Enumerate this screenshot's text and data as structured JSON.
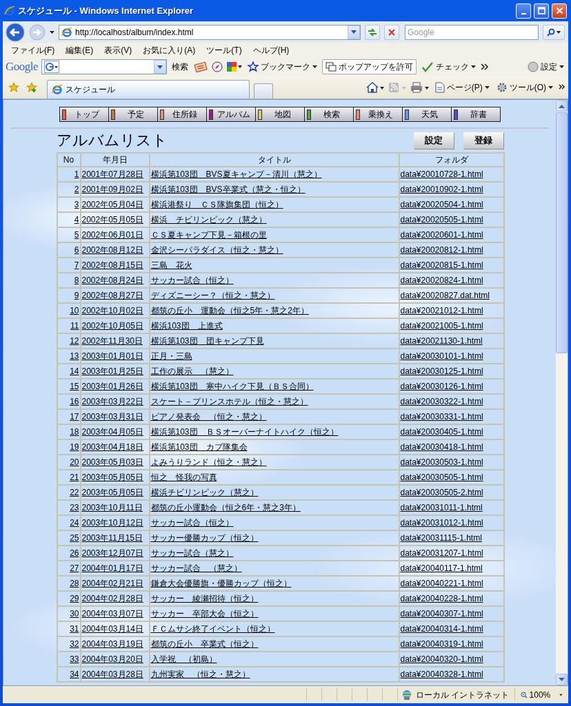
{
  "window": {
    "title": "スケジュール - Windows Internet Explorer"
  },
  "address_bar": {
    "url": "http://localhost/album/index.html"
  },
  "search_box": {
    "placeholder": "Google"
  },
  "menu_bar": [
    "ファイル(F)",
    "編集(E)",
    "表示(V)",
    "お気に入り(A)",
    "ツール(T)",
    "ヘルプ(H)"
  ],
  "google_toolbar": {
    "logo": "Google",
    "search_label": "検索",
    "bookmarks": "ブックマーク",
    "popup": "ポップアップを許可",
    "check": "チェック",
    "settings": "設定"
  },
  "tabs": [
    {
      "label": "スケジュール",
      "selected": true
    }
  ],
  "command_bar": [
    "ページ(P)",
    "ツール(O)"
  ],
  "nav": [
    {
      "label": "トップ",
      "color": "#e06050"
    },
    {
      "label": "予定",
      "color": "#c07840"
    },
    {
      "label": "住所録",
      "color": "#e09078"
    },
    {
      "label": "アルバム",
      "color": "#a01890"
    },
    {
      "label": "地図",
      "color": "#d8d060"
    },
    {
      "label": "検索",
      "color": "#58a040"
    },
    {
      "label": "乗換え",
      "color": "#e09078"
    },
    {
      "label": "天気",
      "color": "#6898e0"
    },
    {
      "label": "辞書",
      "color": "#5050c0"
    }
  ],
  "page_title": "アルバムリスト",
  "buttons": [
    "設定",
    "登録"
  ],
  "table": {
    "columns": [
      "No",
      "年月日",
      "タイトル",
      "フォルダ"
    ],
    "rows": [
      [
        "1",
        "2001年07月28日",
        "横浜第103団　BVS夏キャンプ－清川（慧之）",
        "data¥20010728-1.html"
      ],
      [
        "2",
        "2001年09月02日",
        "横浜第103団　BVS卒業式（慧之・恒之）",
        "data¥20010902-1.html"
      ],
      [
        "3",
        "2002年05月04日",
        "横浜港祭り　ＣＳ隊旗集団（恒之）",
        "data¥20020504-1.html"
      ],
      [
        "4",
        "2002年05月05日",
        "横浜　チビリンピック（慧之）",
        "data¥20020505-1.html"
      ],
      [
        "5",
        "2002年06月01日",
        "ＣＳ夏キャンプ下見－箱根の里",
        "data¥20020601-1.html"
      ],
      [
        "6",
        "2002年08月12日",
        "金沢シーパラダイス（恒之・慧之）",
        "data¥20020812-1.html"
      ],
      [
        "7",
        "2002年08月15日",
        "三島　花火",
        "data¥20020815-1.html"
      ],
      [
        "8",
        "2002年08月24日",
        "サッカー試合（恒之）",
        "data¥20020824-1.html"
      ],
      [
        "9",
        "2002年08月27日",
        "ディズニーシー？（恒之・慧之）",
        "data¥20020827.dat.html"
      ],
      [
        "10",
        "2002年10月02日",
        "都筑の丘小　運動会（恒之5年・慧之2年）",
        "data¥20021012-1.html"
      ],
      [
        "11",
        "2002年10月05日",
        "横浜103団　上進式",
        "data¥20021005-1.html"
      ],
      [
        "12",
        "2002年11月30日",
        "横浜第103団　団キャンプ下見",
        "data¥20021130-1.html"
      ],
      [
        "13",
        "2003年01月01日",
        "正月・三島",
        "data¥20030101-1.html"
      ],
      [
        "14",
        "2003年01月25日",
        "工作の展示　（慧之）",
        "data¥20030125-1.html"
      ],
      [
        "15",
        "2003年01月26日",
        "横浜第103団　寒中ハイク下見（ＢＳ合同）",
        "data¥20030126-1.html"
      ],
      [
        "16",
        "2003年03月22日",
        "スケート－プリンスホテル（恒之・慧之）",
        "data¥20030322-1.html"
      ],
      [
        "17",
        "2003年03月31日",
        "ピアノ発表会　（恒之・慧之）",
        "data¥20030331-1.html"
      ],
      [
        "18",
        "2003年04月05日",
        "横浜第103団　ＢＳオーバーナイトハイク（恒之）",
        "data¥20030405-1.html"
      ],
      [
        "19",
        "2003年04月18日",
        "横浜第103団　カブ隊集会",
        "data¥20030418-1.html"
      ],
      [
        "20",
        "2003年05月03日",
        "よみうりランド（恒之・慧之）",
        "data¥20030503-1.html"
      ],
      [
        "21",
        "2003年05月05日",
        "恒之　怪我の写真",
        "data¥20030505-1.html"
      ],
      [
        "22",
        "2003年05月05日",
        "横浜チビリンピック（慧之）",
        "data¥20030505-2.html"
      ],
      [
        "23",
        "2003年10月11日",
        "都筑の丘小運動会（恒之6年・慧之3年）",
        "data¥20031011-1.html"
      ],
      [
        "24",
        "2003年10月12日",
        "サッカー試合（恒之）",
        "data¥20031012-1.html"
      ],
      [
        "25",
        "2003年11月15日",
        "サッカー優勝カップ（恒之）",
        "data¥20031115-1.html"
      ],
      [
        "26",
        "2003年12月07日",
        "サッカー試合（慧之）",
        "data¥20031207-1.html"
      ],
      [
        "27",
        "2004年01月17日",
        "サッカー試合　（慧之）",
        "data¥20040117-1.html"
      ],
      [
        "28",
        "2004年02月21日",
        "鎌倉大会優勝旗・優勝カップ（恒之）",
        "data¥20040221-1.html"
      ],
      [
        "29",
        "2004年02月28日",
        "サッカー　綾瀬招待（恒之）",
        "data¥20040228-1.html"
      ],
      [
        "30",
        "2004年03月07日",
        "サッカー　卒部大会（恒之）",
        "data¥20040307-1.html"
      ],
      [
        "31",
        "2004年03月14日",
        "ＦＣムサシ終了イベント（恒之）",
        "data¥20040314-1.html"
      ],
      [
        "32",
        "2004年03月19日",
        "都筑の丘小　卒業式（恒之）",
        "data¥20040319-1.html"
      ],
      [
        "33",
        "2004年03月20日",
        "入学祝　（初島）",
        "data¥20040320-1.html"
      ],
      [
        "34",
        "2004年03月28日",
        "九州実家　（恒之・慧之）",
        "data¥20040328-1.html"
      ]
    ]
  },
  "status_bar": {
    "zone": "ローカル イントラネット",
    "zoom": "100%"
  }
}
